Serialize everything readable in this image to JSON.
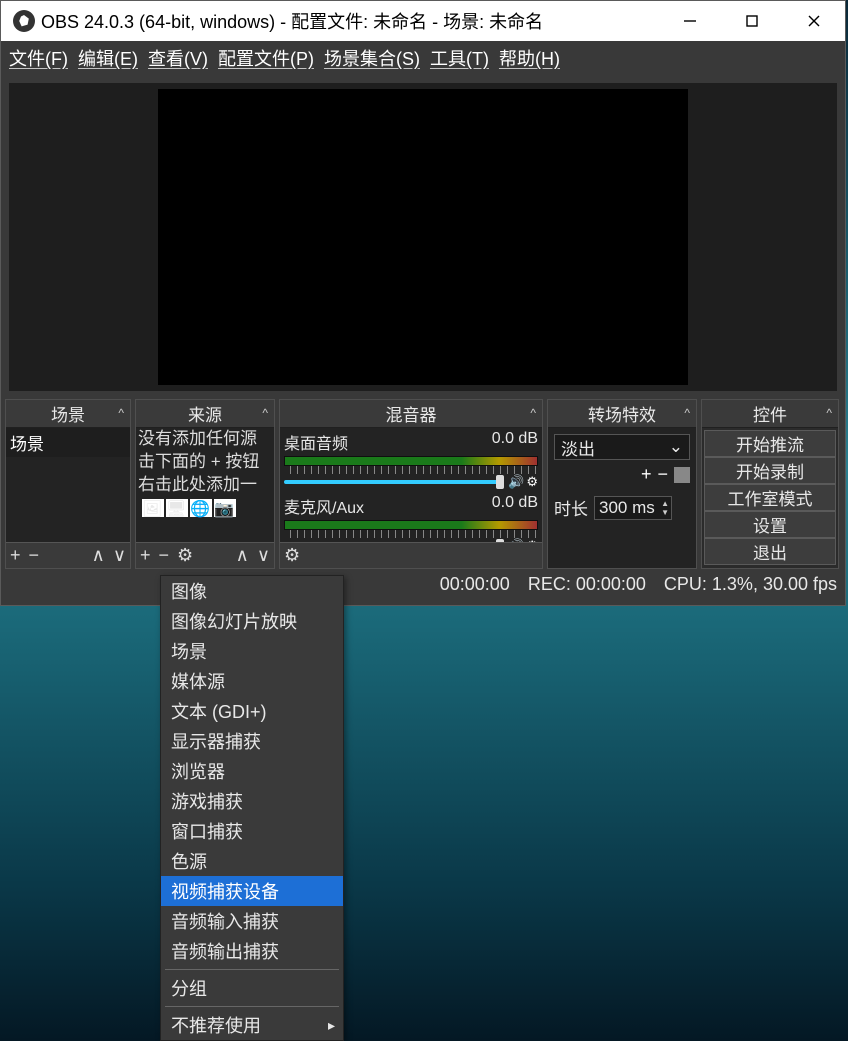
{
  "titlebar": {
    "text": "OBS 24.0.3 (64-bit, windows) - 配置文件: 未命名 - 场景: 未命名"
  },
  "menubar": [
    "文件(F)",
    "编辑(E)",
    "查看(V)",
    "配置文件(P)",
    "场景集合(S)",
    "工具(T)",
    "帮助(H)"
  ],
  "docks": {
    "scenes_title": "场景",
    "sources_title": "来源",
    "mixer_title": "混音器",
    "trans_title": "转场特效",
    "controls_title": "控件"
  },
  "scenes": {
    "items": [
      "场景"
    ]
  },
  "sources": {
    "help1": "没有添加任何源",
    "help2": "击下面的 + 按钮",
    "help3": "右击此处添加一"
  },
  "mixer": {
    "rows": [
      {
        "label": "桌面音频",
        "db": "0.0 dB"
      },
      {
        "label": "麦克风/Aux",
        "db": "0.0 dB"
      }
    ]
  },
  "trans": {
    "selected": "淡出",
    "duration_label": "时长",
    "duration_value": "300 ms"
  },
  "controls": {
    "buttons": [
      "开始推流",
      "开始录制",
      "工作室模式",
      "设置",
      "退出"
    ]
  },
  "statusbar": {
    "live": "00:00:00",
    "rec": "REC: 00:00:00",
    "cpu": "CPU: 1.3%, 30.00 fps"
  },
  "context_menu": {
    "items": [
      {
        "label": "图像",
        "selected": false
      },
      {
        "label": "图像幻灯片放映",
        "selected": false
      },
      {
        "label": "场景",
        "selected": false
      },
      {
        "label": "媒体源",
        "selected": false
      },
      {
        "label": "文本 (GDI+)",
        "selected": false
      },
      {
        "label": "显示器捕获",
        "selected": false
      },
      {
        "label": "浏览器",
        "selected": false
      },
      {
        "label": "游戏捕获",
        "selected": false
      },
      {
        "label": "窗口捕获",
        "selected": false
      },
      {
        "label": "色源",
        "selected": false
      },
      {
        "label": "视频捕获设备",
        "selected": true
      },
      {
        "label": "音频输入捕获",
        "selected": false
      },
      {
        "label": "音频输出捕获",
        "selected": false
      }
    ],
    "group": "分组",
    "deprecated": "不推荐使用"
  }
}
